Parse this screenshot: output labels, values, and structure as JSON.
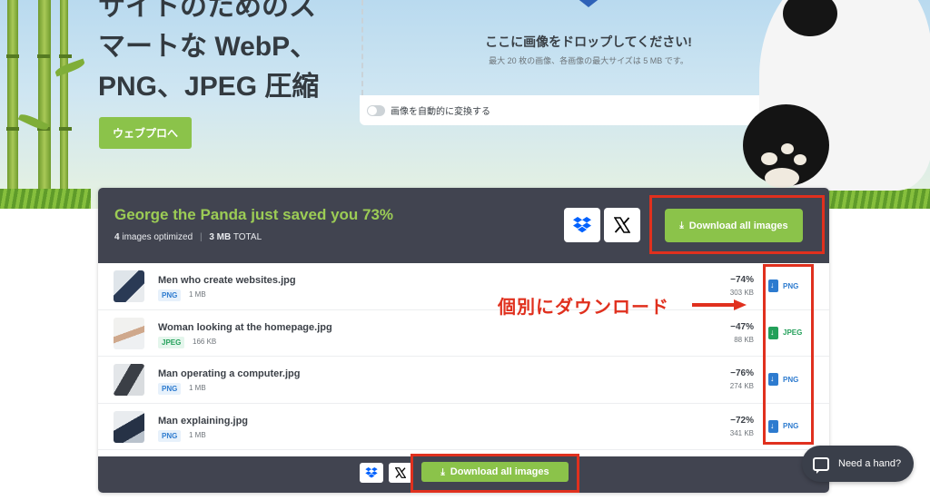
{
  "hero": {
    "title_lines": [
      "サイトのためのス",
      "マートな WebP、",
      "PNG、JPEG 圧縮"
    ],
    "button_label": "ウェブプロへ"
  },
  "upload": {
    "drop_title": "ここに画像をドロップしてください!",
    "drop_sub": "最大 20 枚の画像、各画像の最大サイズは 5 MB です。",
    "auto_convert_label": "画像を自動的に変換する",
    "auto_convert_on": false
  },
  "summary": {
    "title": "George the Panda just saved you 73%",
    "count": "4",
    "count_suffix": "images optimized",
    "total_size": "3 MB",
    "total_label": "TOTAL",
    "download_all_label": "Download all images",
    "dropbox_icon": "dropbox-icon",
    "x_icon": "x-logo-icon"
  },
  "files": [
    {
      "name": "Men who create websites.jpg",
      "type": "PNG",
      "size": "1 MB",
      "saved": "−74%",
      "new_size": "303 KB",
      "download_label": "PNG"
    },
    {
      "name": "Woman looking at the homepage.jpg",
      "type": "JPEG",
      "size": "166 KB",
      "saved": "−47%",
      "new_size": "88 KB",
      "download_label": "JPEG"
    },
    {
      "name": "Man operating a computer.jpg",
      "type": "PNG",
      "size": "1 MB",
      "saved": "−76%",
      "new_size": "274 KB",
      "download_label": "PNG"
    },
    {
      "name": "Man explaining.jpg",
      "type": "PNG",
      "size": "1 MB",
      "saved": "−72%",
      "new_size": "341 KB",
      "download_label": "PNG"
    }
  ],
  "footer": {
    "download_all_label": "Download all images"
  },
  "annotation": {
    "text": "個別にダウンロード",
    "color": "#e0301e"
  },
  "help": {
    "label": "Need a hand?"
  },
  "colors": {
    "accent_green": "#8bc34a",
    "panel_dark": "#414450",
    "png_blue": "#2d7bcf",
    "jpeg_green": "#23a05a"
  }
}
